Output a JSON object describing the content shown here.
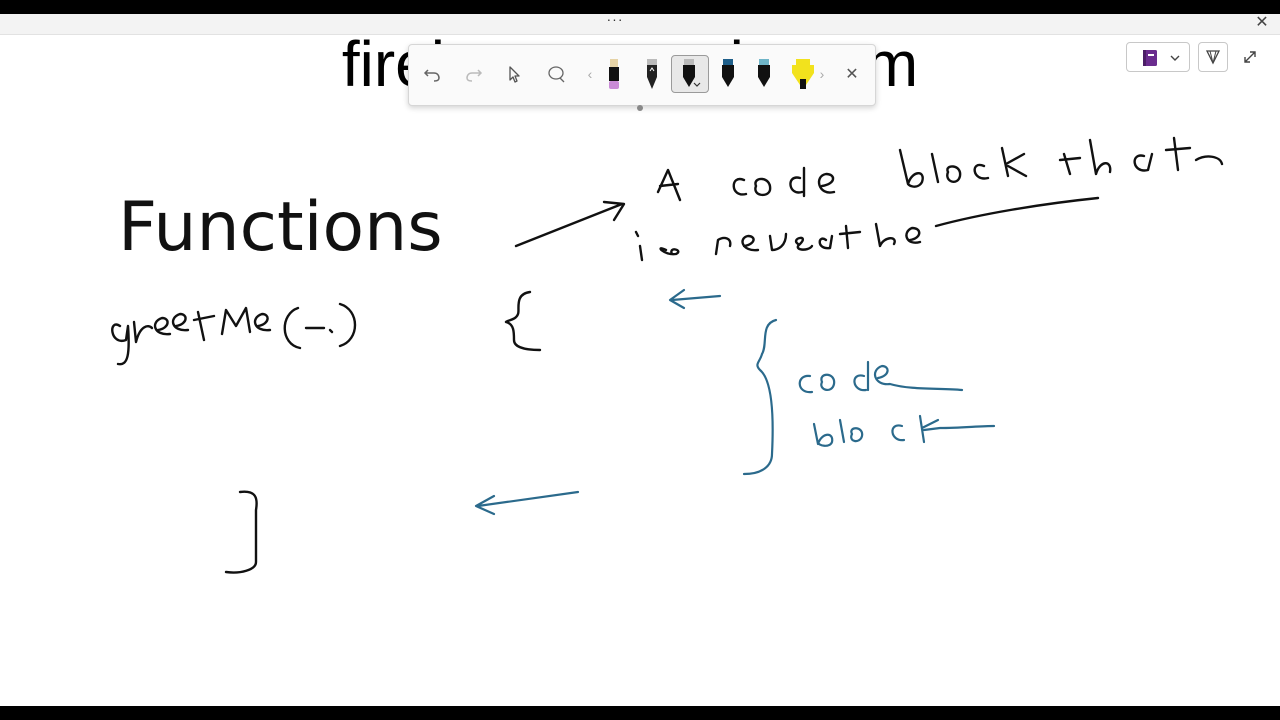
{
  "window": {
    "more_label": "···",
    "close_label": "✕"
  },
  "slide": {
    "url_text": "firebase.google.com",
    "heading": "Functions"
  },
  "toolbar": {
    "tools": [
      {
        "name": "undo-icon",
        "kind": "action"
      },
      {
        "name": "redo-icon",
        "kind": "action"
      },
      {
        "name": "select-pointer-icon",
        "kind": "action"
      },
      {
        "name": "lasso-select-icon",
        "kind": "action"
      },
      {
        "name": "eraser-pen",
        "color": "#c98bd6"
      },
      {
        "name": "pencil-pen",
        "color": "#222222"
      },
      {
        "name": "black-pen",
        "color": "#111111",
        "selected": true
      },
      {
        "name": "blue-pen",
        "color": "#1f5f8a"
      },
      {
        "name": "teal-pen",
        "color": "#2a6f84"
      },
      {
        "name": "highlighter-pen",
        "color": "#f2e21d"
      }
    ],
    "prev_chevron": "‹",
    "next_chevron": "›",
    "close_label": "✕"
  },
  "colors": {
    "ink_black": "#111111",
    "ink_blue": "#2b6a8c",
    "notebook_purple": "#6a2c8e"
  }
}
